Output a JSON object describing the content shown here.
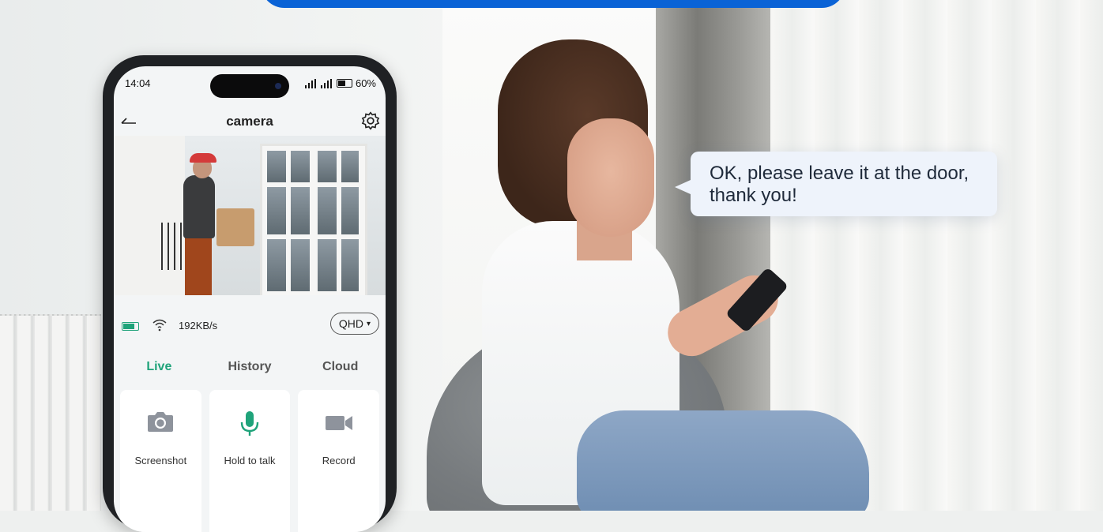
{
  "banner": {
    "color": "#0a63d6"
  },
  "bubble": {
    "text": "OK, please leave it at the door,\nthank you!"
  },
  "phone": {
    "status_bar": {
      "time": "14:04",
      "signal": "ᵒⁿıl ᵒⁿıl",
      "battery": "60%"
    },
    "nav": {
      "title": "camera",
      "back_icon": "back-arrow-icon",
      "settings_icon": "gear-icon"
    },
    "video": {
      "description_icon": "live-camera-feed"
    },
    "info": {
      "speed": "192KB/s",
      "quality": "QHD",
      "quality_arrow": "▾"
    },
    "tabs": [
      {
        "label": "Live",
        "active": true
      },
      {
        "label": "History",
        "active": false
      },
      {
        "label": "Cloud",
        "active": false
      }
    ],
    "actions": [
      {
        "label": "Screenshot",
        "icon": "camera-icon"
      },
      {
        "label": "Hold to talk",
        "icon": "microphone-icon"
      },
      {
        "label": "Record",
        "icon": "video-camera-icon"
      }
    ],
    "accent_color": "#1fa37a"
  }
}
